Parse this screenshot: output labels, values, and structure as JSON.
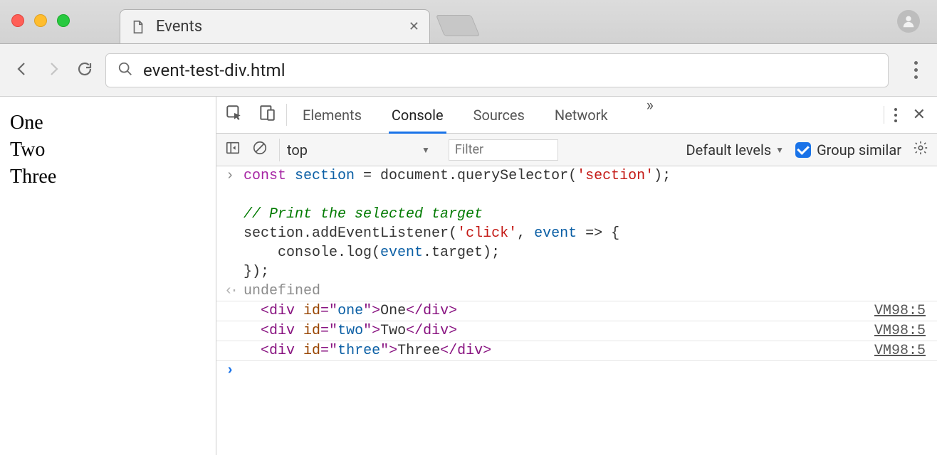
{
  "browser": {
    "tab_title": "Events",
    "omnibox": "event-test-div.html"
  },
  "page": {
    "lines": [
      "One",
      "Two",
      "Three"
    ]
  },
  "devtools": {
    "tabs": [
      "Elements",
      "Console",
      "Sources",
      "Network"
    ],
    "active_tab": "Console",
    "context": "top",
    "filter_placeholder": "Filter",
    "levels_label": "Default levels",
    "group_similar_label": "Group similar",
    "group_similar_checked": true
  },
  "console": {
    "input_code": {
      "l1_kw": "const",
      "l1_var": " section",
      "l1_rest": " = document.querySelector(",
      "l1_str": "'section'",
      "l1_end": ");",
      "comment": "// Print the selected target",
      "l2a": "section.addEventListener(",
      "l2_str": "'click'",
      "l2b": ", ",
      "l2_var": "event",
      "l2c": " => {",
      "l3a": "    console.log(",
      "l3_var": "event",
      "l3b": ".target);",
      "l4": "});"
    },
    "return_value": "undefined",
    "logs": [
      {
        "tag_open": "<div ",
        "attr": "id",
        "eq": "=\"",
        "val": "one",
        "after": "\">",
        "text": "One",
        "close": "</div>",
        "src": "VM98:5"
      },
      {
        "tag_open": "<div ",
        "attr": "id",
        "eq": "=\"",
        "val": "two",
        "after": "\">",
        "text": "Two",
        "close": "</div>",
        "src": "VM98:5"
      },
      {
        "tag_open": "<div ",
        "attr": "id",
        "eq": "=\"",
        "val": "three",
        "after": "\">",
        "text": "Three",
        "close": "</div>",
        "src": "VM98:5"
      }
    ]
  }
}
